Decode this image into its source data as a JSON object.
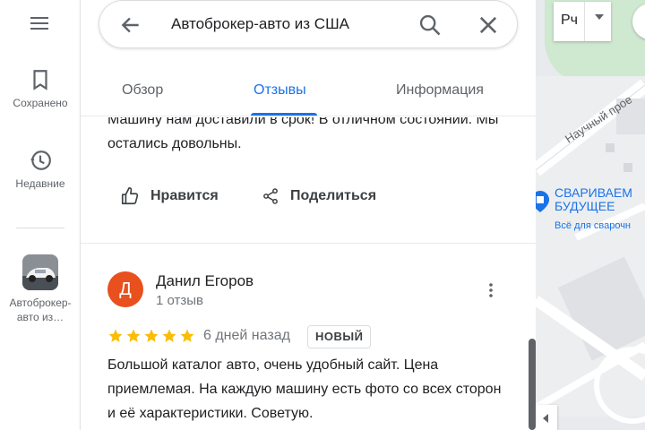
{
  "rail": {
    "saved_label": "Сохранено",
    "recent_label": "Недавние",
    "place_label_line1": "Автоброкер-",
    "place_label_line2": "авто из…"
  },
  "search": {
    "query": "Автоброкер-авто из США"
  },
  "tabs": {
    "overview": "Обзор",
    "reviews": "Отзывы",
    "info": "Информация"
  },
  "previous_review": {
    "text": "Машину нам доставили в срок! В отличном состоянии. Мы остались довольны.",
    "like_label": "Нравится",
    "share_label": "Поделиться"
  },
  "review": {
    "avatar_letter": "Д",
    "author": "Данил Егоров",
    "count": "1 отзыв",
    "rating": 5,
    "date": "6 дней назад",
    "badge": "НОВЫЙ",
    "text": "Большой каталог авто, очень удобный сайт. Цена приемлемая. На каждую машину есть фото со всех сторон и её характеристики. Советую."
  },
  "map": {
    "lang_label": "Рч",
    "street_label": "Научный прое",
    "poi_line1": "СВАРИВАЕМ",
    "poi_line2": "БУДУЩЕЕ",
    "poi_line3": "Всё для сварочн"
  },
  "colors": {
    "accent": "#1a73e8",
    "star": "#fbbc04",
    "avatar_bg": "#e8501d"
  }
}
